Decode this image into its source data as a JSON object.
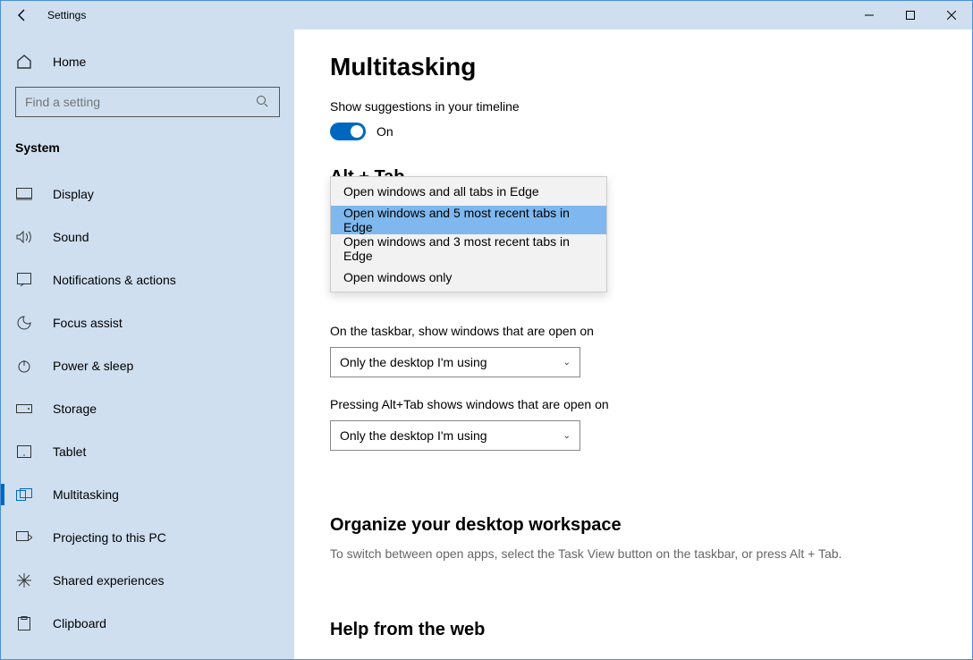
{
  "titlebar": {
    "title": "Settings"
  },
  "sidebar": {
    "home": "Home",
    "search_placeholder": "Find a setting",
    "header": "System",
    "items": [
      {
        "label": "Display"
      },
      {
        "label": "Sound"
      },
      {
        "label": "Notifications & actions"
      },
      {
        "label": "Focus assist"
      },
      {
        "label": "Power & sleep"
      },
      {
        "label": "Storage"
      },
      {
        "label": "Tablet"
      },
      {
        "label": "Multitasking"
      },
      {
        "label": "Projecting to this PC"
      },
      {
        "label": "Shared experiences"
      },
      {
        "label": "Clipboard"
      }
    ]
  },
  "page": {
    "title": "Multitasking",
    "timeline_label": "Show suggestions in your timeline",
    "timeline_state": "On",
    "alttab_heading": "Alt + Tab",
    "alttab_options": [
      "Open windows and all tabs in Edge",
      "Open windows and 5 most recent tabs in Edge",
      "Open windows and 3 most recent tabs in Edge",
      "Open windows only"
    ],
    "taskbar_label": "On the taskbar, show windows that are open on",
    "taskbar_value": "Only the desktop I'm using",
    "alttab2_label": "Pressing Alt+Tab shows windows that are open on",
    "alttab2_value": "Only the desktop I'm using",
    "organize_heading": "Organize your desktop workspace",
    "organize_hint": "To switch between open apps, select the Task View button on the taskbar, or press Alt + Tab.",
    "help_heading": "Help from the web"
  }
}
